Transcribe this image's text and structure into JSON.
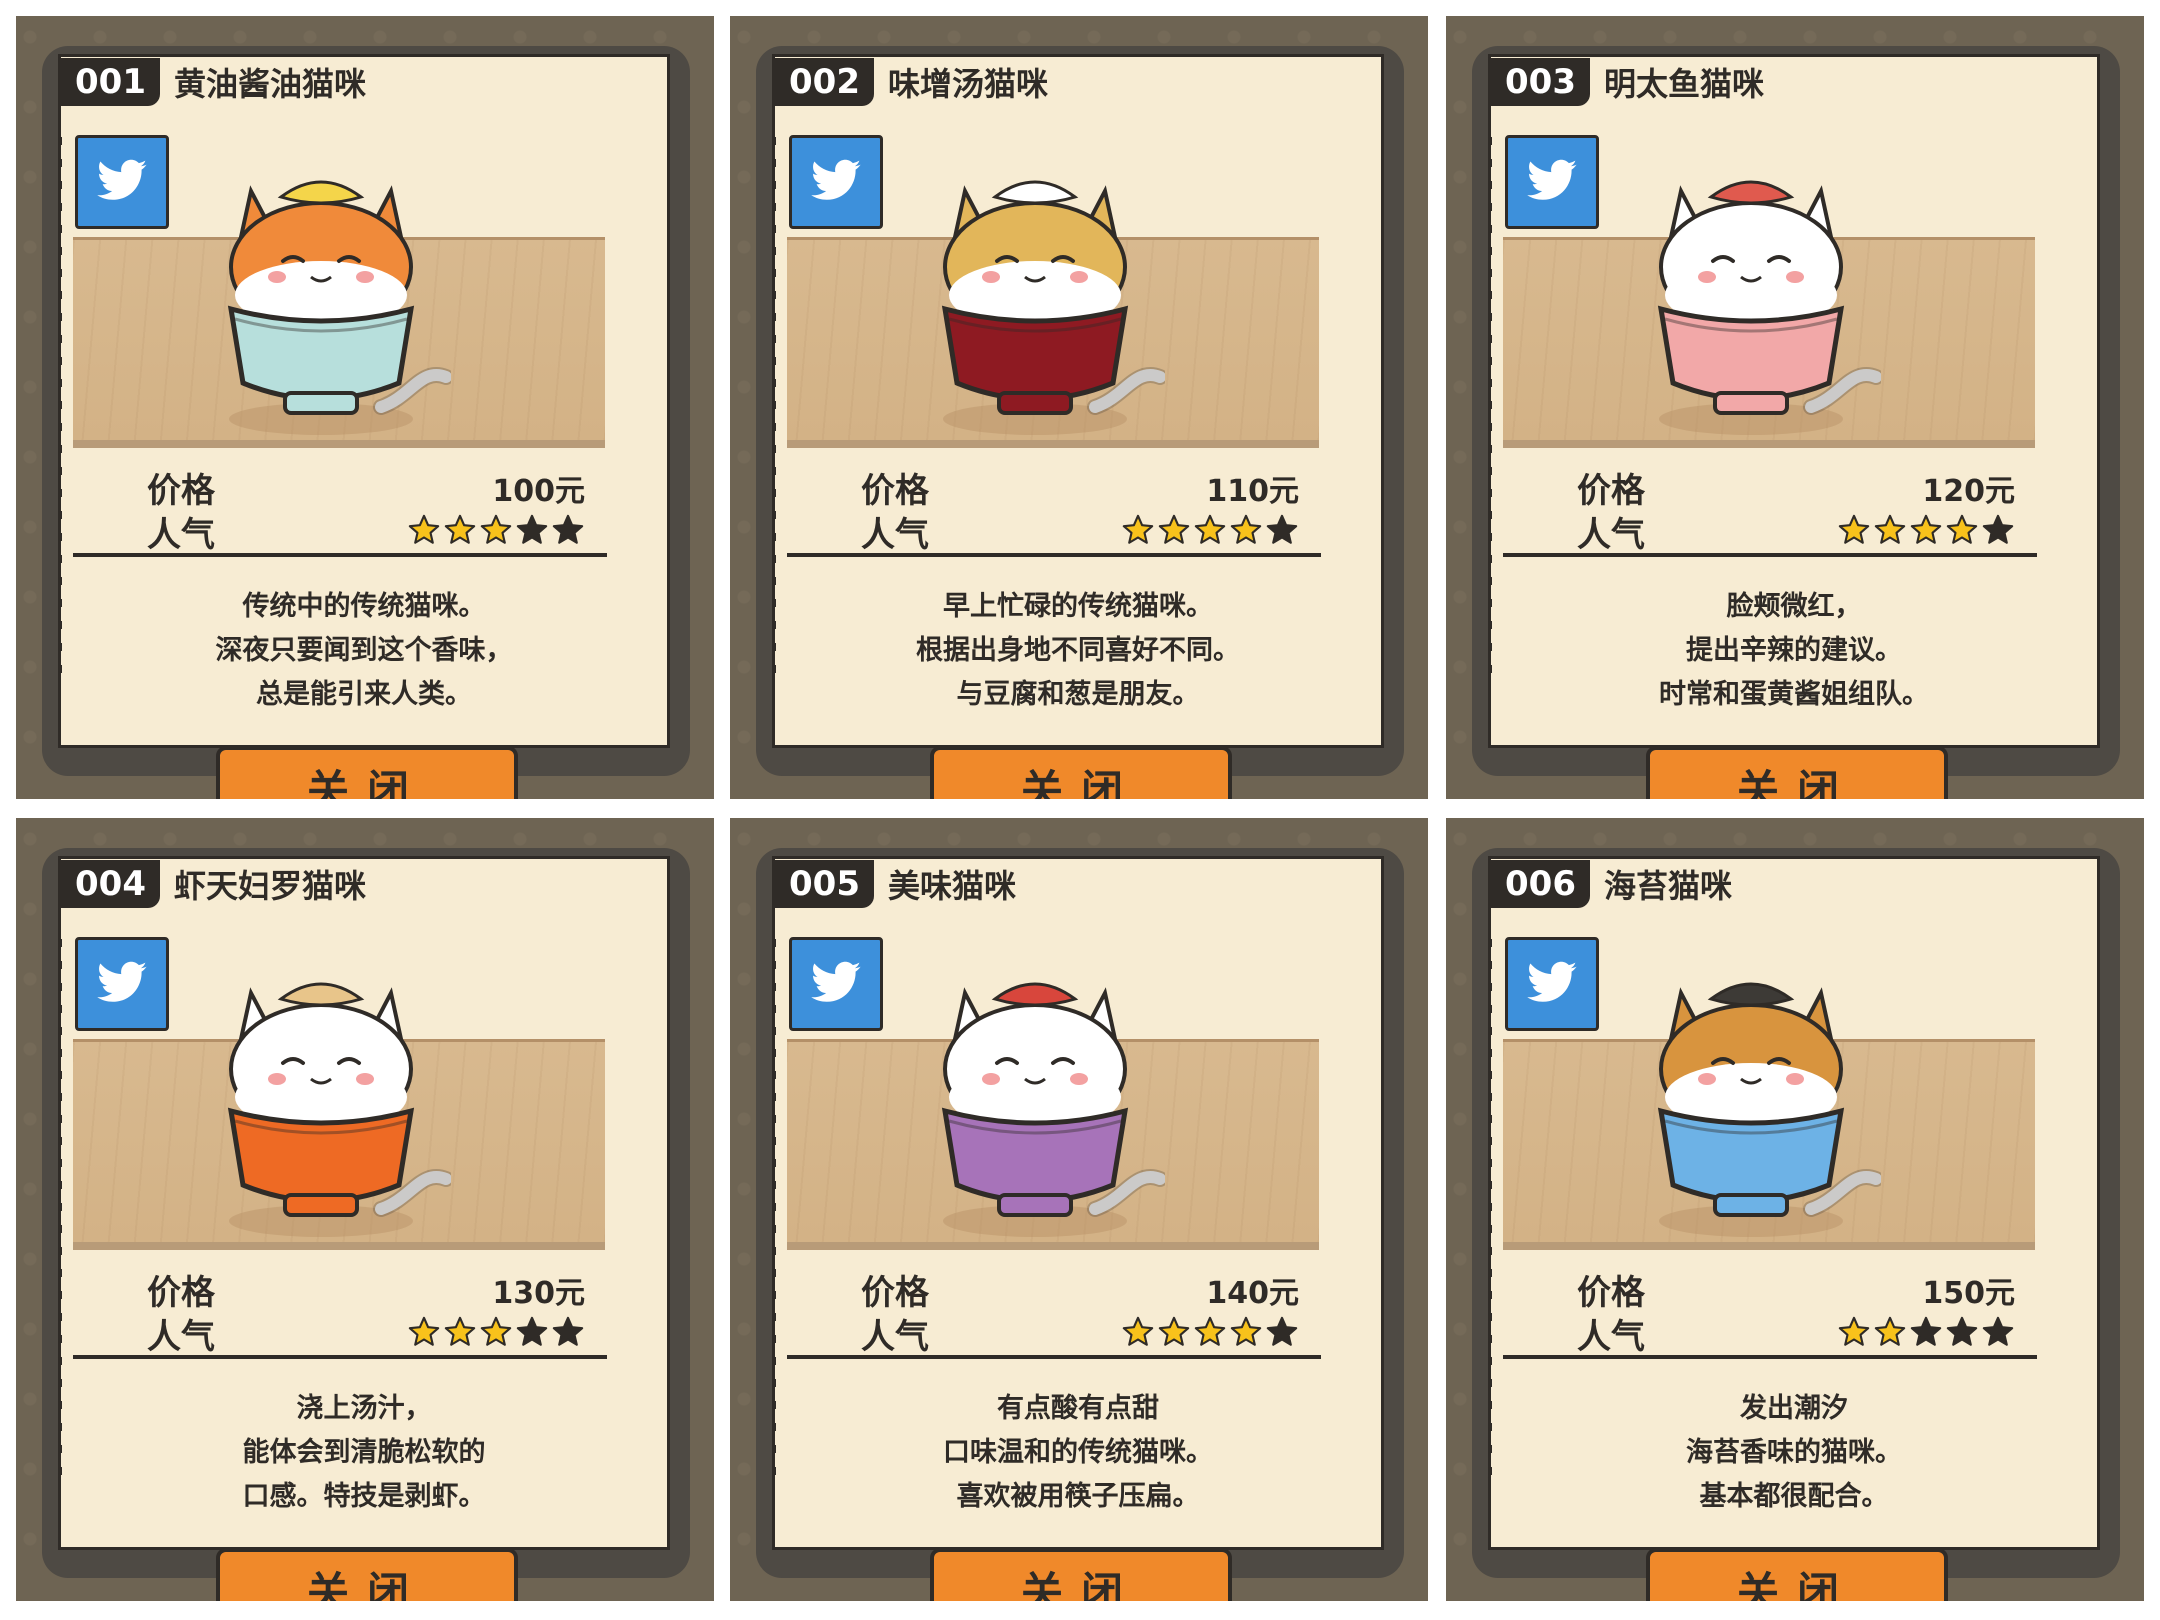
{
  "cards": [
    {
      "num": "001",
      "title": "黄油酱油猫咪",
      "price_label": "价格",
      "price": "100元",
      "pop_label": "人气",
      "stars": 3,
      "desc": [
        "传统中的传统猫咪。",
        "深夜只要闻到这个香味，",
        "总是能引来人类。"
      ],
      "close": "关闭",
      "bowl": "#b7dfdc",
      "fur": "#f08a3a",
      "top": "#f4d54a"
    },
    {
      "num": "002",
      "title": "味增汤猫咪",
      "price_label": "价格",
      "price": "110元",
      "pop_label": "人气",
      "stars": 4,
      "desc": [
        "早上忙碌的传统猫咪。",
        "根据出身地不同喜好不同。",
        "与豆腐和葱是朋友。"
      ],
      "close": "关闭",
      "bowl": "#8e1a22",
      "fur": "#e2b65a",
      "top": "#ffffff"
    },
    {
      "num": "003",
      "title": "明太鱼猫咪",
      "price_label": "价格",
      "price": "120元",
      "pop_label": "人气",
      "stars": 4,
      "desc": [
        "脸颊微红，",
        "提出辛辣的建议。",
        "时常和蛋黄酱姐组队。"
      ],
      "close": "关闭",
      "bowl": "#f2a8a8",
      "fur": "#ffffff",
      "top": "#e05a4e"
    },
    {
      "num": "004",
      "title": "虾天妇罗猫咪",
      "price_label": "价格",
      "price": "130元",
      "pop_label": "人气",
      "stars": 3,
      "desc": [
        "浇上汤汁，",
        "能体会到清脆松软的",
        "口感。特技是剥虾。"
      ],
      "close": "关闭",
      "bowl": "#ee6a24",
      "fur": "#ffffff",
      "top": "#e8c58a"
    },
    {
      "num": "005",
      "title": "美味猫咪",
      "price_label": "价格",
      "price": "140元",
      "pop_label": "人气",
      "stars": 4,
      "desc": [
        "有点酸有点甜",
        "口味温和的传统猫咪。",
        "喜欢被用筷子压扁。"
      ],
      "close": "关闭",
      "bowl": "#a773b9",
      "fur": "#ffffff",
      "top": "#d8463c"
    },
    {
      "num": "006",
      "title": "海苔猫咪",
      "price_label": "价格",
      "price": "150元",
      "pop_label": "人气",
      "stars": 2,
      "desc": [
        "发出潮汐",
        "海苔香味的猫咪。",
        "基本都很配合。"
      ],
      "close": "关闭",
      "bowl": "#6db2e6",
      "fur": "#d8943e",
      "top": "#3d3a36"
    }
  ]
}
